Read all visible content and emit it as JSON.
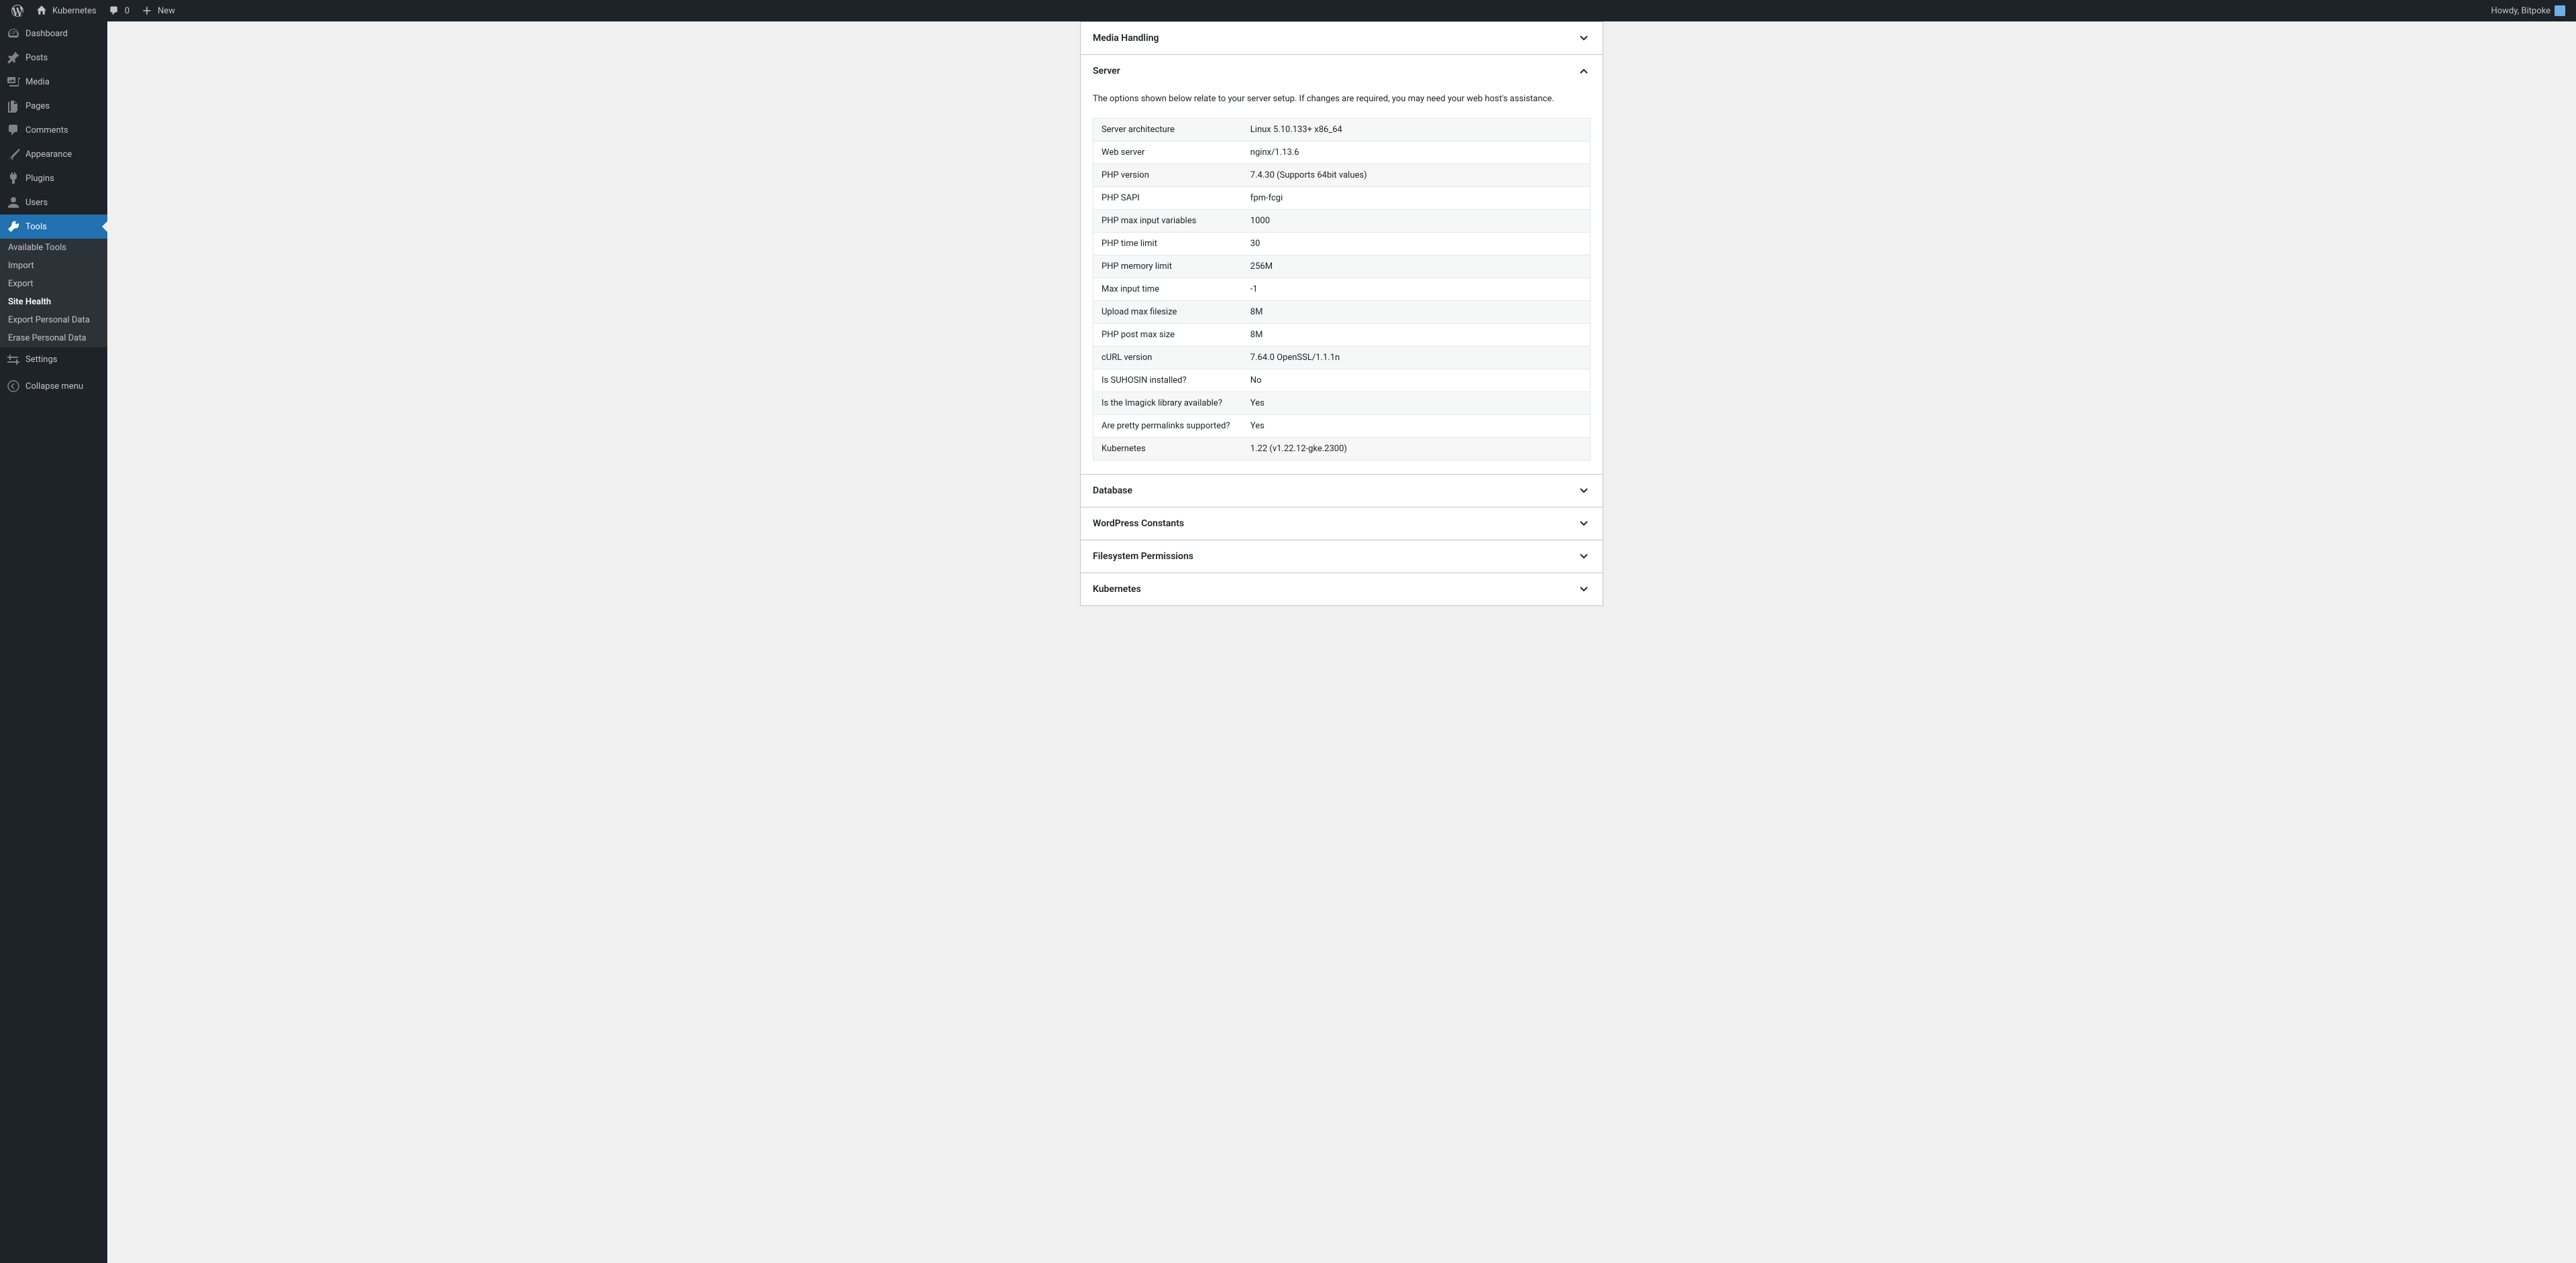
{
  "adminbar": {
    "site_name": "Kubernetes",
    "comments_count": "0",
    "new_label": "New",
    "howdy": "Howdy, Bitpoke"
  },
  "sidebar": {
    "dashboard": "Dashboard",
    "posts": "Posts",
    "media": "Media",
    "pages": "Pages",
    "comments": "Comments",
    "appearance": "Appearance",
    "plugins": "Plugins",
    "users": "Users",
    "tools": "Tools",
    "settings": "Settings",
    "collapse": "Collapse menu",
    "tools_sub": {
      "available": "Available Tools",
      "import": "Import",
      "export": "Export",
      "site_health": "Site Health",
      "export_personal": "Export Personal Data",
      "erase_personal": "Erase Personal Data"
    }
  },
  "panels": {
    "media_handling": "Media Handling",
    "server": {
      "title": "Server",
      "desc": "The options shown below relate to your server setup. If changes are required, you may need your web host's assistance.",
      "rows": [
        {
          "label": "Server architecture",
          "value": "Linux 5.10.133+ x86_64"
        },
        {
          "label": "Web server",
          "value": "nginx/1.13.6"
        },
        {
          "label": "PHP version",
          "value": "7.4.30 (Supports 64bit values)"
        },
        {
          "label": "PHP SAPI",
          "value": "fpm-fcgi"
        },
        {
          "label": "PHP max input variables",
          "value": "1000"
        },
        {
          "label": "PHP time limit",
          "value": "30"
        },
        {
          "label": "PHP memory limit",
          "value": "256M"
        },
        {
          "label": "Max input time",
          "value": "-1"
        },
        {
          "label": "Upload max filesize",
          "value": "8M"
        },
        {
          "label": "PHP post max size",
          "value": "8M"
        },
        {
          "label": "cURL version",
          "value": "7.64.0 OpenSSL/1.1.1n"
        },
        {
          "label": "Is SUHOSIN installed?",
          "value": "No"
        },
        {
          "label": "Is the Imagick library available?",
          "value": "Yes"
        },
        {
          "label": "Are pretty permalinks supported?",
          "value": "Yes"
        },
        {
          "label": "Kubernetes",
          "value": "1.22 (v1.22.12-gke.2300)"
        }
      ]
    },
    "database": "Database",
    "wp_constants": "WordPress Constants",
    "fs_permissions": "Filesystem Permissions",
    "kubernetes": "Kubernetes"
  }
}
